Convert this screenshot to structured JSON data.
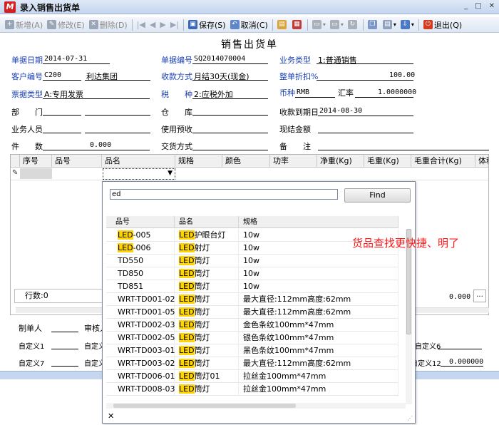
{
  "window": {
    "title": "录入销售出货单",
    "logo": "M",
    "buttons": [
      "_",
      "□",
      "✕"
    ]
  },
  "toolbar": {
    "items": [
      {
        "label": "新增(A)",
        "icon": "new-icon",
        "disabled": true
      },
      {
        "label": "修改(E)",
        "icon": "edit-icon",
        "disabled": true
      },
      {
        "label": "删除(D)",
        "icon": "delete-icon",
        "disabled": true
      },
      {
        "label": "保存(S)",
        "icon": "save-icon",
        "disabled": false
      },
      {
        "label": "取消(C)",
        "icon": "cancel-icon",
        "disabled": false
      },
      {
        "label": "退出(Q)",
        "icon": "exit-icon",
        "disabled": false
      }
    ]
  },
  "form": {
    "heading": "销售出货单",
    "doc_date_label": "单据日期",
    "doc_date": "2014-07-31",
    "doc_no_label": "单据编号",
    "doc_no": "SQ2014070004",
    "biz_type_label": "业务类型",
    "biz_type": "1:普通销售",
    "cust_code_label": "客户编号",
    "cust_code": "C200",
    "cust_name": "利达集团",
    "pay_method_label": "收款方式",
    "pay_method": "月结30天(现金)",
    "discount_label": "整单折扣%",
    "discount": "100.00",
    "invoice_type_label": "票据类型",
    "invoice_type": "A:专用发票",
    "tax_label": "税　　种",
    "tax": "2:应税外加",
    "currency_label": "币种",
    "currency": "RMB",
    "rate_label": "汇率",
    "rate": "1.0000000",
    "dept_label": "部　　门",
    "warehouse_label": "仓　　库",
    "due_date_label": "收款到期日",
    "due_date": "2014-08-30",
    "salesman_label": "业务人员",
    "prepay_label": "使用预收",
    "cash_label": "现结金额",
    "qty_label": "件　　数",
    "qty": "0.000",
    "trade_label": "交货方式",
    "remark_label": "备　　注"
  },
  "grid": {
    "columns": [
      "序号",
      "品号",
      "品名",
      "规格",
      "颜色",
      "功率",
      "净重(Kg)",
      "毛重(Kg)",
      "毛重合计(Kg)",
      "体积"
    ],
    "row_count_label": "行数:0",
    "total": "0.000",
    "more": "..."
  },
  "bottom": {
    "maker_label": "制单人",
    "auditor_label": "审核人",
    "custom1": "自定义1",
    "custom2": "自定义",
    "custom6": "自定义6",
    "custom7": "自定义7",
    "custom8": "自定义",
    "custom12": "自定义12",
    "custom12_value": "0.000000"
  },
  "dropdown": {
    "search_value": "ed",
    "find_label": "Find",
    "columns": [
      "品号",
      "品名",
      "规格"
    ],
    "rows": [
      {
        "code_hl": "LED",
        "code_rest": "-005",
        "name_hl": "LED",
        "name_rest": "护眼台灯",
        "spec": "10w"
      },
      {
        "code_hl": "LED",
        "code_rest": "-006",
        "name_hl": "LED",
        "name_rest": "射灯",
        "spec": "10w"
      },
      {
        "code_hl": "",
        "code_rest": "TD550",
        "name_hl": "LED",
        "name_rest": "筒灯",
        "spec": "10w"
      },
      {
        "code_hl": "",
        "code_rest": "TD850",
        "name_hl": "LED",
        "name_rest": "筒灯",
        "spec": "10w"
      },
      {
        "code_hl": "",
        "code_rest": "TD851",
        "name_hl": "LED",
        "name_rest": "筒灯",
        "spec": "10w"
      },
      {
        "code_hl": "",
        "code_rest": "WRT-TD001-02",
        "name_hl": "LED",
        "name_rest": "筒灯",
        "spec": "最大直径:112mm高度:62mm"
      },
      {
        "code_hl": "",
        "code_rest": "WRT-TD001-05",
        "name_hl": "LED",
        "name_rest": "筒灯",
        "spec": "最大直径:112mm高度:62mm"
      },
      {
        "code_hl": "",
        "code_rest": "WRT-TD002-03",
        "name_hl": "LED",
        "name_rest": "筒灯",
        "spec": "金色条纹100mm*47mm"
      },
      {
        "code_hl": "",
        "code_rest": "WRT-TD002-05",
        "name_hl": "LED",
        "name_rest": "筒灯",
        "spec": "银色条纹100mm*47mm"
      },
      {
        "code_hl": "",
        "code_rest": "WRT-TD003-01",
        "name_hl": "LED",
        "name_rest": "筒灯",
        "spec": "黑色条纹100mm*47mm"
      },
      {
        "code_hl": "",
        "code_rest": "WRT-TD003-02",
        "name_hl": "LED",
        "name_rest": "筒灯",
        "spec": "最大直径:112mm高度:62mm"
      },
      {
        "code_hl": "",
        "code_rest": "WRT-TD006-01",
        "name_hl": "LED",
        "name_rest": "筒灯01",
        "spec": "拉丝金100mm*47mm"
      },
      {
        "code_hl": "",
        "code_rest": "WRT-TD008-03",
        "name_hl": "LED",
        "name_rest": "筒灯",
        "spec": "拉丝金100mm*47mm"
      }
    ],
    "close_icon": "✕"
  },
  "annotation": "货品查找更快捷、明了",
  "colors": {
    "highlight": "#ffd400",
    "label_blue": "#1a3fb5",
    "annotation_red": "#ff1a1a"
  }
}
